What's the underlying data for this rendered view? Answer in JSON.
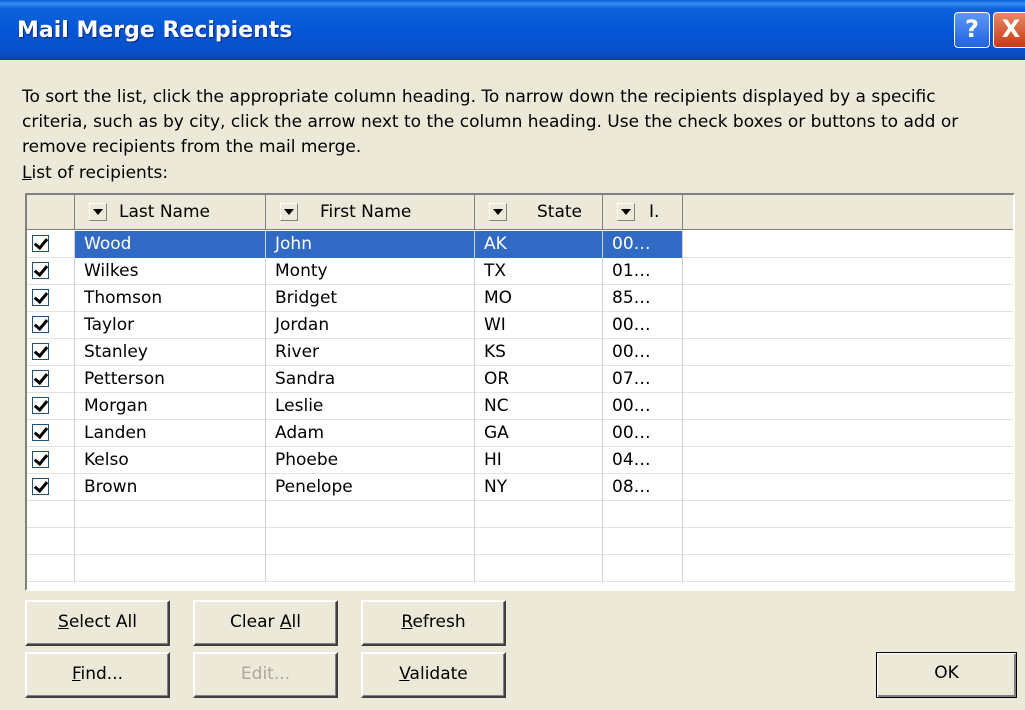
{
  "window": {
    "title": "Mail Merge Recipients",
    "help_glyph": "?",
    "close_glyph": "X"
  },
  "instructions": "To sort the list, click the appropriate column heading.  To narrow down the recipients displayed by a specific criteria, such as by city, click the arrow next to the column heading.  Use the check boxes or buttons to add or remove recipients from the mail merge.",
  "list_label": {
    "mnemonic": "L",
    "rest": "ist of recipients:"
  },
  "columns": [
    "Last Name",
    "First Name",
    "State",
    "I."
  ],
  "recipients": [
    {
      "checked": true,
      "last": "Wood",
      "first": "John",
      "state": "AK",
      "id": "00…",
      "selected": true
    },
    {
      "checked": true,
      "last": "Wilkes",
      "first": "Monty",
      "state": "TX",
      "id": "01…"
    },
    {
      "checked": true,
      "last": "Thomson",
      "first": "Bridget",
      "state": "MO",
      "id": "85…"
    },
    {
      "checked": true,
      "last": "Taylor",
      "first": "Jordan",
      "state": "WI",
      "id": "00…"
    },
    {
      "checked": true,
      "last": "Stanley",
      "first": "River",
      "state": "KS",
      "id": "00…"
    },
    {
      "checked": true,
      "last": "Petterson",
      "first": "Sandra",
      "state": "OR",
      "id": "07…"
    },
    {
      "checked": true,
      "last": "Morgan",
      "first": "Leslie",
      "state": "NC",
      "id": "00…"
    },
    {
      "checked": true,
      "last": "Landen",
      "first": "Adam",
      "state": "GA",
      "id": "00…"
    },
    {
      "checked": true,
      "last": "Kelso",
      "first": "Phoebe",
      "state": "HI",
      "id": "04…"
    },
    {
      "checked": true,
      "last": "Brown",
      "first": "Penelope",
      "state": "NY",
      "id": "08…"
    }
  ],
  "buttons": {
    "select_all": {
      "mnemonic": "S",
      "rest": "elect All"
    },
    "clear_all": {
      "pre": "Clear ",
      "mnemonic": "A",
      "rest": "ll"
    },
    "refresh": {
      "mnemonic": "R",
      "rest": "efresh"
    },
    "find": {
      "mnemonic": "F",
      "rest": "ind..."
    },
    "edit": {
      "label": "Edit..."
    },
    "validate": {
      "mnemonic": "V",
      "rest": "alidate"
    },
    "ok": {
      "label": "OK"
    }
  }
}
